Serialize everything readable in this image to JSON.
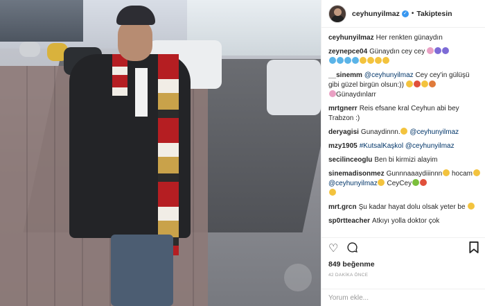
{
  "header": {
    "username": "ceyhunyilmaz",
    "verified_icon": "check-icon",
    "separator": "•",
    "follow_state": "Takiptesin"
  },
  "comments": [
    {
      "user": "ceyhunyilmaz",
      "text": "Her renkten günaydın"
    },
    {
      "user": "zeynepce04",
      "text": "Günaydın cey cey"
    },
    {
      "user": "__sinemm",
      "mention": "@ceyhunyilmaz",
      "text": "Cey cey'in gülüşü gibi güzel birgün olsun:))",
      "text2": "Günaydınlarr"
    },
    {
      "user": "mrtgnerr",
      "text": "Reis efsane kral Ceyhun abi bey Trabzon :)"
    },
    {
      "user": "deryagisi",
      "text": "Gunaydinnn.",
      "mention": "@ceyhunyilmaz"
    },
    {
      "user": "mzy1905",
      "mention": "#KutsalKaşkol",
      "mention2": "@ceyhunyilmaz"
    },
    {
      "user": "secilinceoglu",
      "text": "Ben bi kirmizi alayim"
    },
    {
      "user": "sinemadisonmez",
      "text": "Gunnnaaaydiiinnn",
      "text2": "hocam",
      "mention": "@ceyhunyilmaz",
      "text3": "CeyCey"
    },
    {
      "user": "mrt.grcn",
      "text": "Şu kadar hayat dolu olsak yeter be"
    },
    {
      "user": "sp0rtteacher",
      "text": "Atkıyı yolla doktor çok"
    }
  ],
  "actions": {
    "like_icon": "heart-icon",
    "comment_icon": "comment-icon",
    "save_icon": "bookmark-icon",
    "likes": "849 beğenme",
    "time": "42 DAKİKA ÖNCE"
  },
  "add_comment": {
    "placeholder": "Yorum ekle..."
  }
}
